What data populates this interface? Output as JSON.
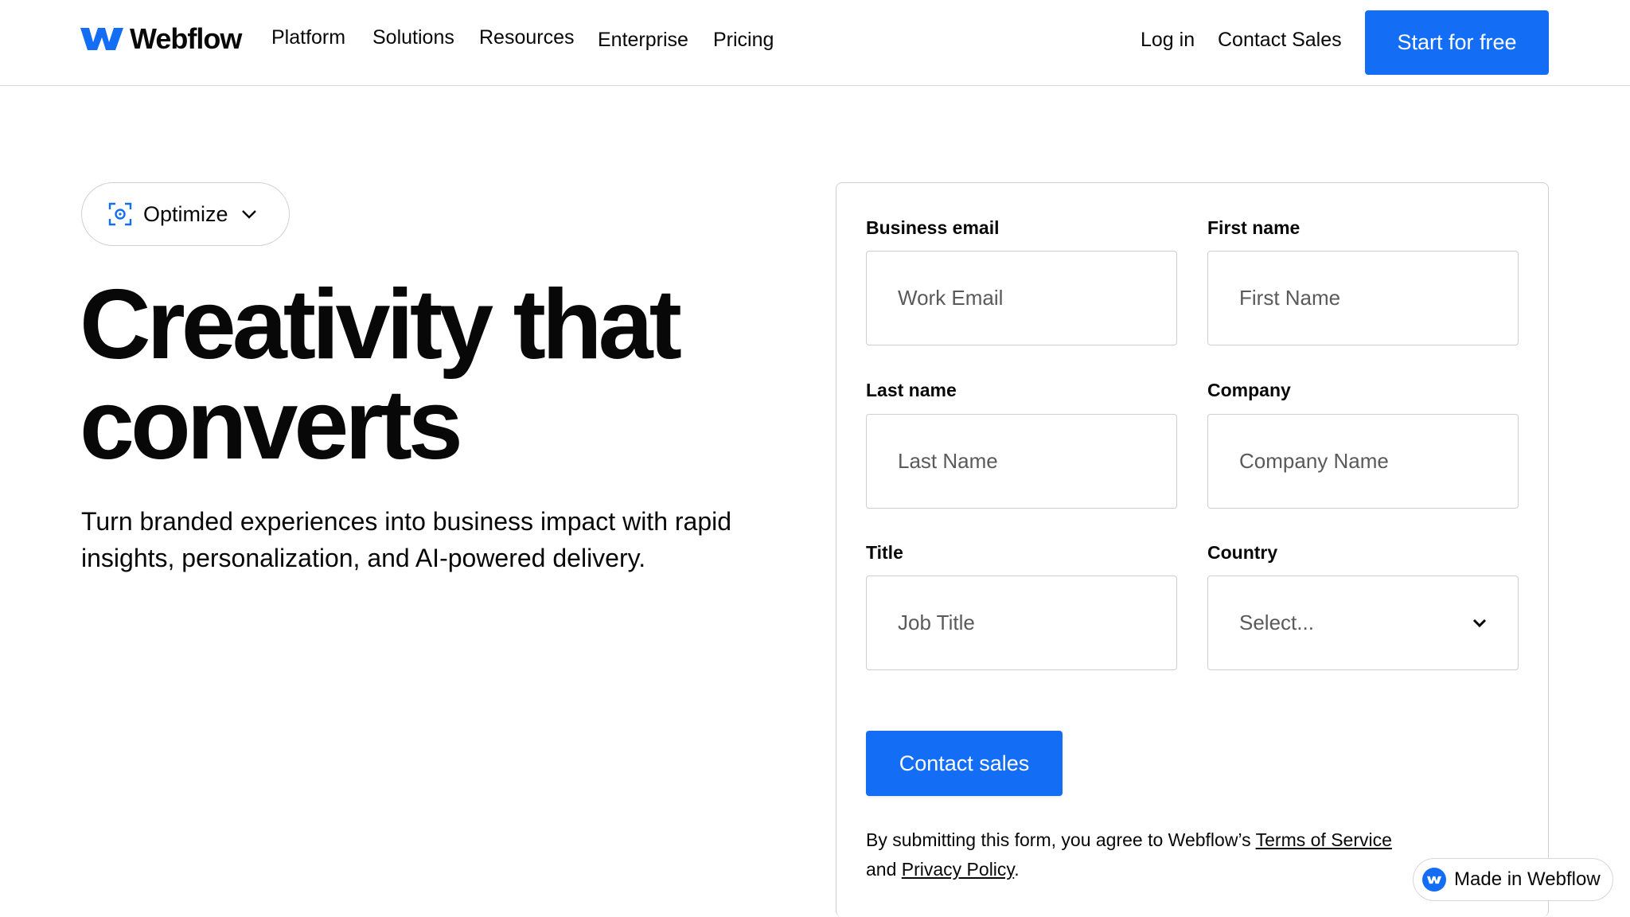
{
  "brand": {
    "name": "Webflow",
    "accent_color": "#146ef5"
  },
  "nav": {
    "items": [
      {
        "label": "Platform"
      },
      {
        "label": "Solutions"
      },
      {
        "label": "Resources"
      },
      {
        "label": "Enterprise"
      },
      {
        "label": "Pricing"
      }
    ],
    "login_label": "Log in",
    "contact_sales_label": "Contact Sales",
    "start_label": "Start for free"
  },
  "hero": {
    "pill_label": "Optimize",
    "pill_icon": "focus-target-icon",
    "title_line1": "Creativity that",
    "title_line2": "converts",
    "subtitle": "Turn branded experiences into business impact with rapid insights, personalization, and AI-powered delivery."
  },
  "form": {
    "business_email": {
      "label": "Business email",
      "placeholder": "Work Email"
    },
    "first_name": {
      "label": "First name",
      "placeholder": "First Name"
    },
    "last_name": {
      "label": "Last name",
      "placeholder": "Last Name"
    },
    "company": {
      "label": "Company",
      "placeholder": "Company Name"
    },
    "title": {
      "label": "Title",
      "placeholder": "Job Title"
    },
    "country": {
      "label": "Country",
      "value": "Select..."
    },
    "submit_label": "Contact sales",
    "legal_prefix": "By submitting this form, you agree to Webflow’s ",
    "terms_label": "Terms of Service",
    "legal_middle": " and ",
    "privacy_label": "Privacy Policy",
    "legal_suffix": "."
  },
  "badge": {
    "label": "Made in Webflow"
  }
}
